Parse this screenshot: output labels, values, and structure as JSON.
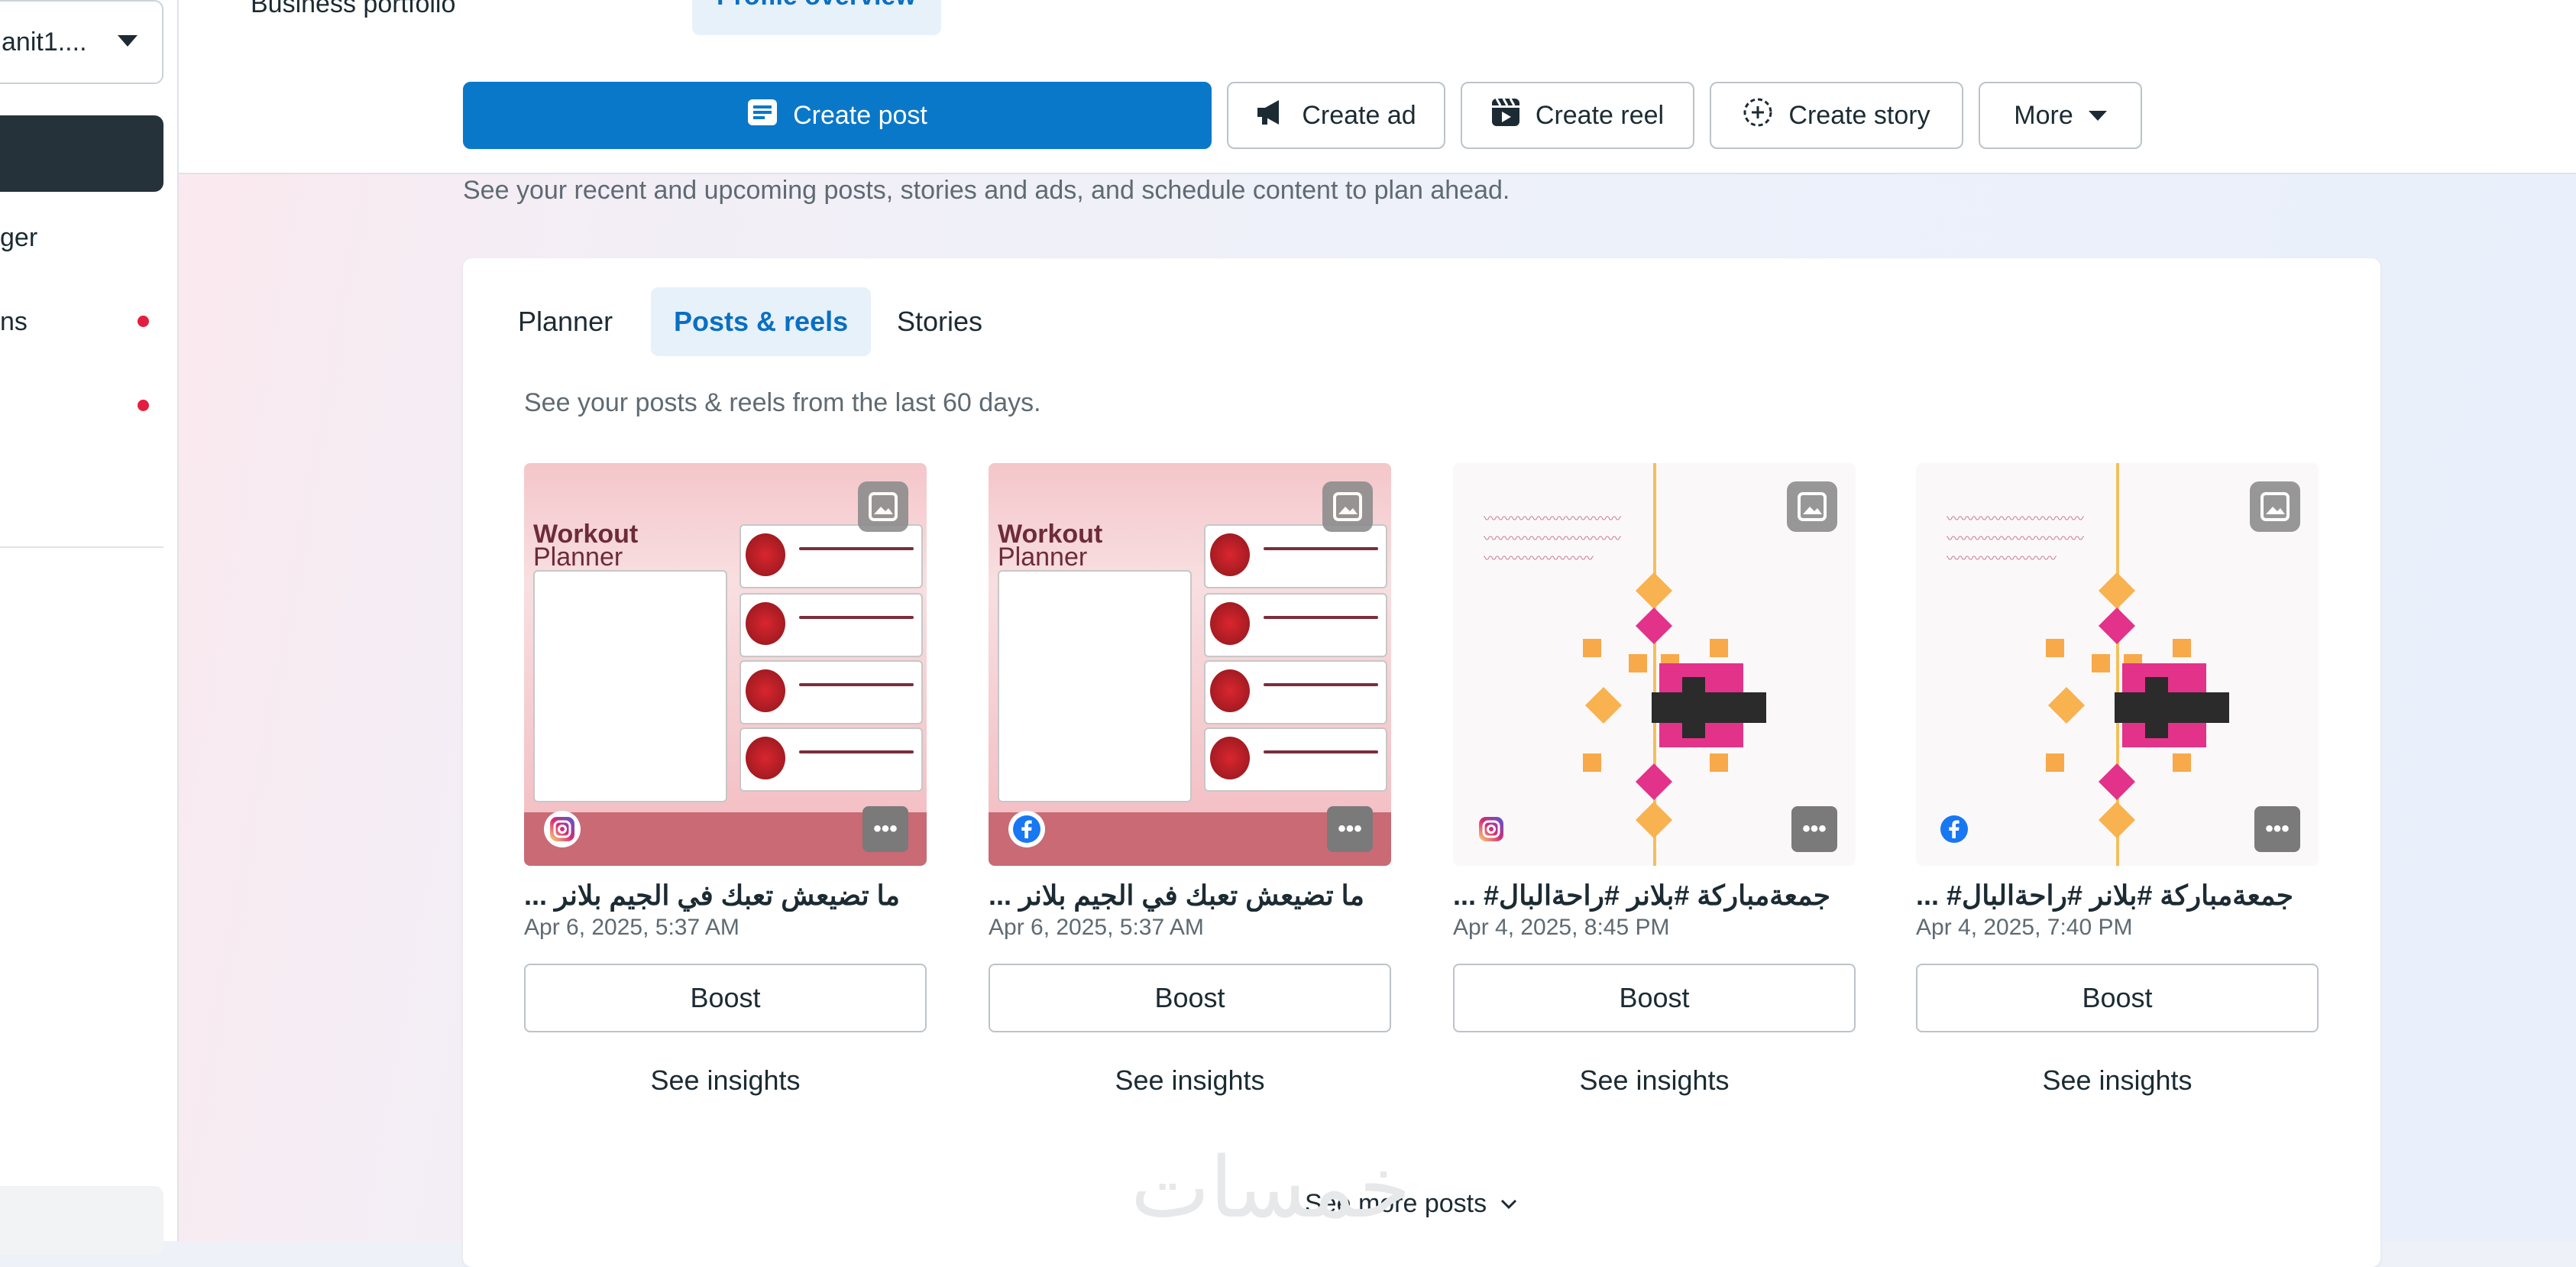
{
  "sidebar": {
    "account_label": "anit1....",
    "items": [
      {
        "label": "ger",
        "dot": false
      },
      {
        "label": "ns",
        "dot": true
      },
      {
        "label": "",
        "dot": true
      }
    ]
  },
  "header": {
    "top_links": [
      "Business portfolio",
      "Profile overview"
    ],
    "actions": {
      "create_post": "Create post",
      "create_ad": "Create ad",
      "create_reel": "Create reel",
      "create_story": "Create story",
      "more": "More"
    },
    "subtitle": "See your recent and upcoming posts, stories and ads, and schedule content to plan ahead."
  },
  "content": {
    "tabs": [
      "Planner",
      "Posts & reels",
      "Stories"
    ],
    "active_tab": "Posts & reels",
    "description": "See your posts & reels from the last 60 days.",
    "posts": [
      {
        "title": "... ما تضيعش تعبك في الجيم بلانر",
        "date": "Apr 6, 2025, 5:37 AM",
        "platform": "instagram",
        "preview": "workout-planner",
        "boost": "Boost",
        "insights": "See insights"
      },
      {
        "title": "... ما تضيعش تعبك في الجيم بلانر",
        "date": "Apr 6, 2025, 5:37 AM",
        "platform": "facebook",
        "preview": "workout-planner",
        "boost": "Boost",
        "insights": "See insights"
      },
      {
        "title": "... #جمعة‌مباركة #بلانر #راحة‌البال",
        "date": "Apr 4, 2025, 8:45 PM",
        "platform": "instagram",
        "preview": "jumuah-art",
        "boost": "Boost",
        "insights": "See insights"
      },
      {
        "title": "... #جمعة‌مباركة #بلانر #راحة‌البال",
        "date": "Apr 4, 2025, 7:40 PM",
        "platform": "facebook",
        "preview": "jumuah-art",
        "boost": "Boost",
        "insights": "See insights"
      }
    ],
    "preview_text": {
      "workout_title_1": "Workout",
      "workout_title_2": "Planner"
    },
    "see_more": "See more posts"
  },
  "watermark": "خمسات",
  "colors": {
    "primary": "#0a78c8",
    "active_tab_bg": "#e7f1fa",
    "active_tab_text": "#0a6fc2",
    "sidebar_active": "#253239",
    "notification_dot": "#e41e3f",
    "facebook_blue": "#1877f2"
  },
  "icons": {
    "create_post": "document-icon",
    "create_ad": "megaphone-icon",
    "create_reel": "clapperboard-icon",
    "create_story": "story-plus-icon",
    "more": "chevron-down-icon"
  }
}
